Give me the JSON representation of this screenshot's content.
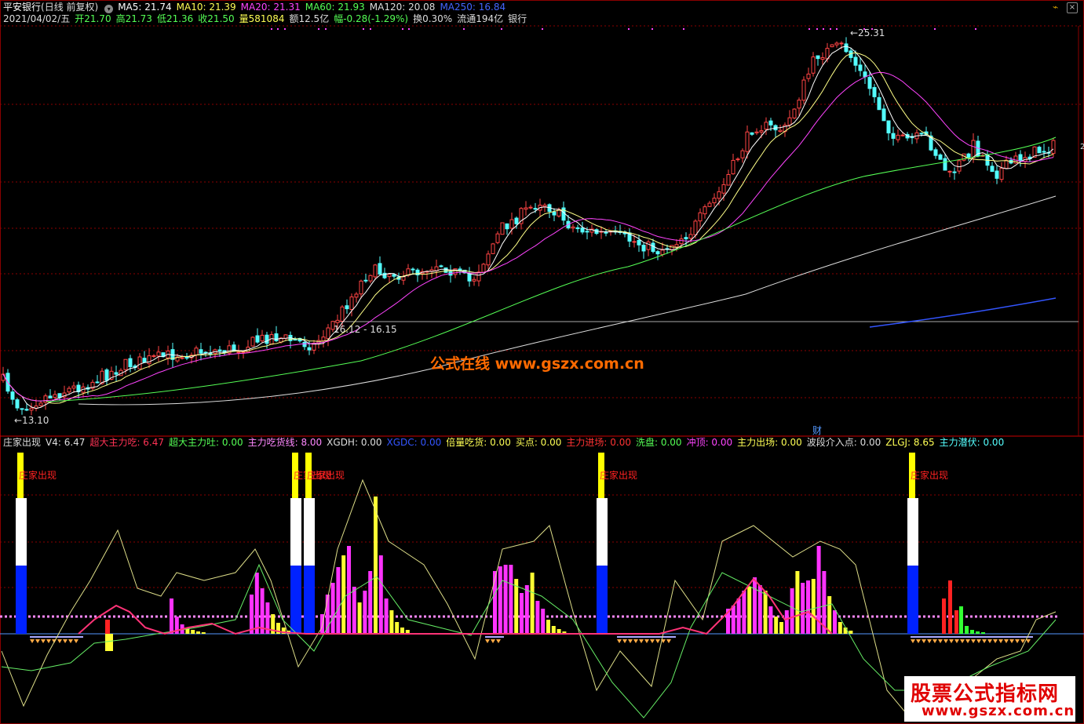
{
  "window": {
    "title": "平安银行",
    "mode": "(日线 前复权)",
    "close_label": "×",
    "ripple_label": "⌁"
  },
  "ma_legend": [
    {
      "text": "MA5: 21.74",
      "color": "#ffffff"
    },
    {
      "text": "MA10: 21.39",
      "color": "#ffff55"
    },
    {
      "text": "MA20: 21.31",
      "color": "#ff44ff"
    },
    {
      "text": "MA60: 21.93",
      "color": "#55ff55"
    },
    {
      "text": "MA120: 20.08",
      "color": "#dddddd"
    },
    {
      "text": "MA250: 16.84",
      "color": "#4466ff"
    }
  ],
  "quote": [
    {
      "text": "2021/04/02/五",
      "color": "#dddddd"
    },
    {
      "text": "开21.70",
      "color": "#55ff55"
    },
    {
      "text": "高21.73",
      "color": "#55ff55"
    },
    {
      "text": "低21.36",
      "color": "#55ff55"
    },
    {
      "text": "收21.50",
      "color": "#55ff55"
    },
    {
      "text": "量581084",
      "color": "#ffff55"
    },
    {
      "text": "额12.5亿",
      "color": "#dddddd"
    },
    {
      "text": "幅-0.28(-1.29%)",
      "color": "#55ff55"
    },
    {
      "text": "换0.30%",
      "color": "#dddddd"
    },
    {
      "text": "流通194亿",
      "color": "#dddddd"
    },
    {
      "text": "银行",
      "color": "#dddddd"
    }
  ],
  "price_labels": {
    "high": "25.31",
    "low": "13.10",
    "level": "16.12 - 16.15",
    "right_edge": "2",
    "fin_marker": "财"
  },
  "indicator": {
    "name": "庄家出现",
    "values": [
      {
        "text": "V4: 6.47",
        "color": "#dddddd"
      },
      {
        "text": "超大主力吃: 6.47",
        "color": "#ff3355"
      },
      {
        "text": "超大主力吐: 0.00",
        "color": "#55ff55"
      },
      {
        "text": "主力吃货线: 8.00",
        "color": "#ff88ff"
      },
      {
        "text": "XGDH: 0.00",
        "color": "#dddddd"
      },
      {
        "text": "XGDC: 0.00",
        "color": "#3355ff"
      },
      {
        "text": "倍量吃货: 0.00",
        "color": "#ffff55"
      },
      {
        "text": "买点: 0.00",
        "color": "#ffff55"
      },
      {
        "text": "主力进场: 0.00",
        "color": "#ff3333"
      },
      {
        "text": "洗盘: 0.00",
        "color": "#55ff55"
      },
      {
        "text": "冲顶: 0.00",
        "color": "#ff44ff"
      },
      {
        "text": "主力出场: 0.00",
        "color": "#ffff55"
      },
      {
        "text": "波段介入点: 0.00",
        "color": "#dddddd"
      },
      {
        "text": "ZLGJ: 8.65",
        "color": "#ffff55"
      },
      {
        "text": "主力潜伏: 0.00",
        "color": "#55ffff"
      }
    ],
    "signal_label": "庄家出现",
    "signal_overlap_label": "庄家出现",
    "signal_positions": [
      0.02,
      0.27,
      0.28,
      0.55,
      0.84
    ]
  },
  "watermarks": {
    "center": "公式在线  www.gszx.com.cn",
    "corner_line1": "股票公式指标网",
    "corner_line2": "www.gszx.com.cn"
  },
  "colors": {
    "up": "#ff4444",
    "down": "#54ffff",
    "grid": "#8b0000"
  }
}
